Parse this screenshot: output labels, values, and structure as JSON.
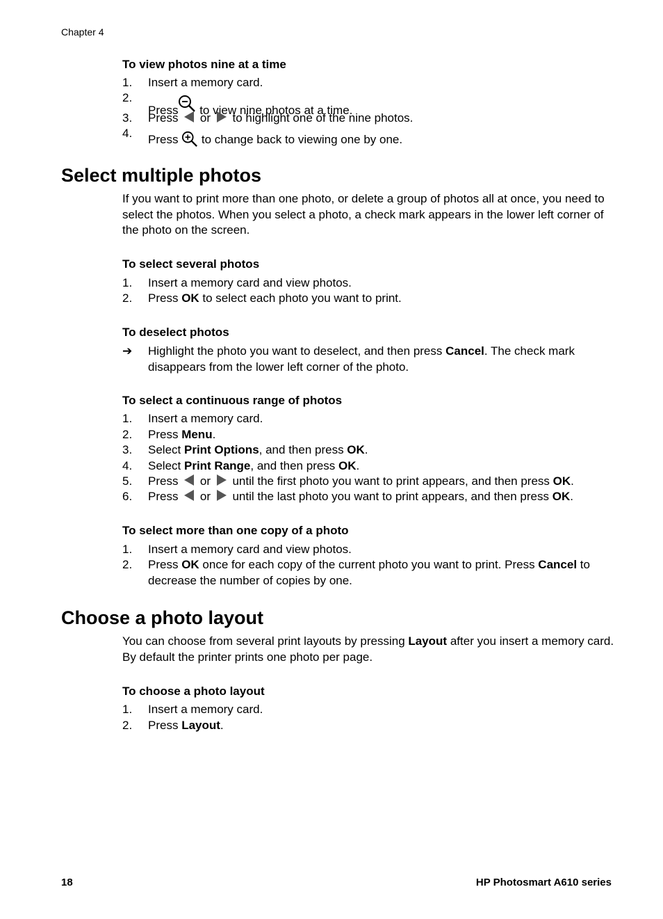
{
  "header": {
    "chapter": "Chapter 4"
  },
  "footer": {
    "page_number": "18",
    "product": "HP Photosmart A610 series"
  },
  "sections": {
    "view_nine": {
      "heading": "To view photos nine at a time",
      "steps": [
        {
          "num": "1.",
          "text": "Insert a memory card."
        },
        {
          "num": "2.",
          "pre": "Press",
          "icon": "zoom-out-icon",
          "post": " to view nine photos at a time."
        },
        {
          "num": "3.",
          "pre": "Press ",
          "mid": " or ",
          "post": " to highlight one of the nine photos."
        },
        {
          "num": "4.",
          "pre": "Press ",
          "icon": "zoom-in-icon",
          "post": " to change back to viewing one by one."
        }
      ]
    },
    "select_multiple": {
      "title": "Select multiple photos",
      "intro": "If you want to print more than one photo, or delete a group of photos all at once, you need to select the photos. When you select a photo, a check mark appears in the lower left corner of the photo on the screen.",
      "several": {
        "heading": "To select several photos",
        "steps": [
          {
            "num": "1.",
            "text": "Insert a memory card and view photos."
          },
          {
            "num": "2.",
            "pre": "Press ",
            "bold": "OK",
            "post": " to select each photo you want to print."
          }
        ]
      },
      "deselect": {
        "heading": "To deselect photos",
        "arrow": "➔",
        "pre": "Highlight the photo you want to deselect, and then press ",
        "bold": "Cancel",
        "post": ". The check mark disappears from the lower left corner of the photo."
      },
      "range": {
        "heading": "To select a continuous range of photos",
        "steps": [
          {
            "num": "1.",
            "text": "Insert a memory card."
          },
          {
            "num": "2.",
            "pre": "Press ",
            "bold": "Menu",
            "post": "."
          },
          {
            "num": "3.",
            "pre": "Select ",
            "bold": "Print Options",
            "mid": ", and then press ",
            "bold2": "OK",
            "post": "."
          },
          {
            "num": "4.",
            "pre": "Select ",
            "bold": "Print Range",
            "mid": ", and then press ",
            "bold2": "OK",
            "post": "."
          },
          {
            "num": "5.",
            "pre": "Press ",
            "mid": " or ",
            "post": " until the first photo you want to print appears, and then press ",
            "bold": "OK",
            "end": "."
          },
          {
            "num": "6.",
            "pre": "Press ",
            "mid": " or ",
            "post": " until the last photo you want to print appears, and then press ",
            "bold": "OK",
            "end": "."
          }
        ]
      },
      "copies": {
        "heading": "To select more than one copy of a photo",
        "steps": [
          {
            "num": "1.",
            "text": "Insert a memory card and view photos."
          },
          {
            "num": "2.",
            "pre": "Press ",
            "bold": "OK",
            "mid": " once for each copy of the current photo you want to print. Press ",
            "bold2": "Cancel",
            "post": " to decrease the number of copies by one."
          }
        ]
      }
    },
    "layout": {
      "title": "Choose a photo layout",
      "intro_pre": "You can choose from several print layouts by pressing ",
      "intro_bold": "Layout",
      "intro_post": " after you insert a memory card. By default the printer prints one photo per page.",
      "choose": {
        "heading": "To choose a photo layout",
        "steps": [
          {
            "num": "1.",
            "text": "Insert a memory card."
          },
          {
            "num": "2.",
            "pre": "Press ",
            "bold": "Layout",
            "post": "."
          }
        ]
      }
    }
  }
}
